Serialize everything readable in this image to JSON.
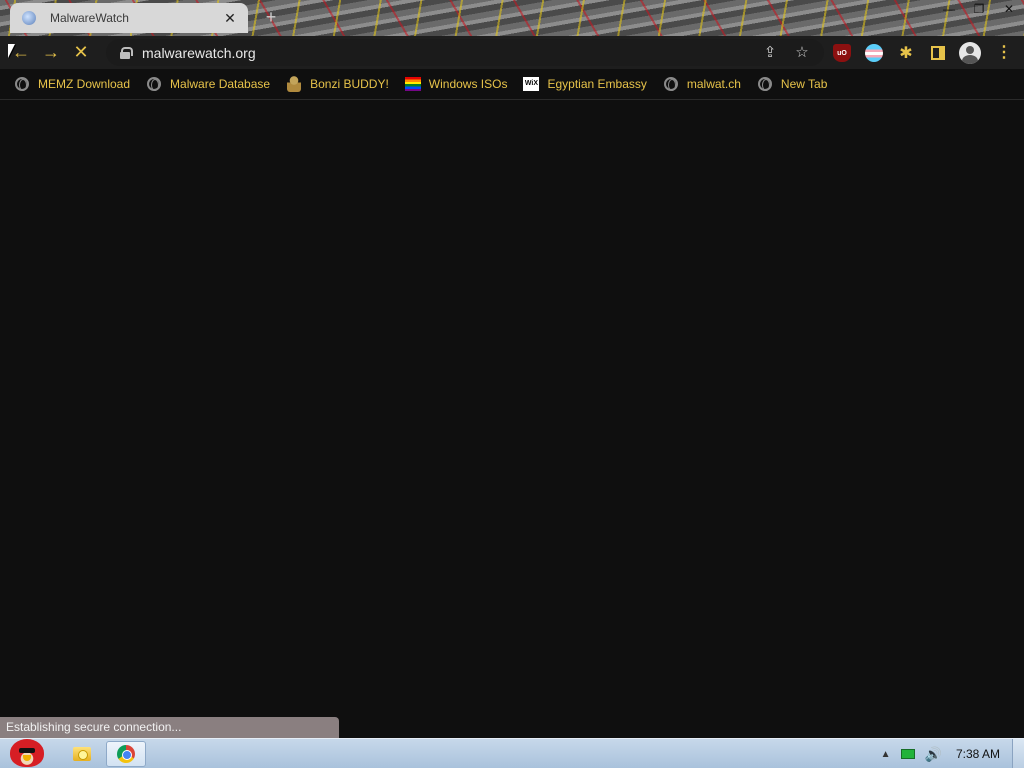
{
  "window": {
    "tab_title": "MalwareWatch",
    "tab_close": "✕",
    "new_tab": "+",
    "minimize": "—",
    "maximize": "❐",
    "close": "✕"
  },
  "toolbar": {
    "back_glyph": "←",
    "forward_glyph": "→",
    "stop_glyph": "✕",
    "url": "malwarewatch.org",
    "share_glyph": "⇪",
    "star_glyph": "☆",
    "ublock_text": "uO",
    "puzzle_glyph": "✱",
    "menu_glyph": "⋮"
  },
  "bookmarks": [
    {
      "label": "MEMZ Download",
      "icon": "globe-icon"
    },
    {
      "label": "Malware Database",
      "icon": "globe-icon"
    },
    {
      "label": "Bonzi BUDDY!",
      "icon": "bonzi-icon"
    },
    {
      "label": "Windows ISOs",
      "icon": "rainbow-flag-icon"
    },
    {
      "label": "Egyptian Embassy",
      "icon": "wix-icon",
      "icon_text": "WiX"
    },
    {
      "label": "malwat.ch",
      "icon": "globe-icon"
    },
    {
      "label": "New Tab",
      "icon": "globe-icon"
    }
  ],
  "status": {
    "text": "Establishing secure connection..."
  },
  "taskbar": {
    "tray_arrow": "▲",
    "volume_glyph": "🔊",
    "clock": "7:38 AM"
  },
  "colors": {
    "accent": "#e7c34a",
    "page_background": "#0f0f0f",
    "status_bubble": "#8a7f80"
  }
}
